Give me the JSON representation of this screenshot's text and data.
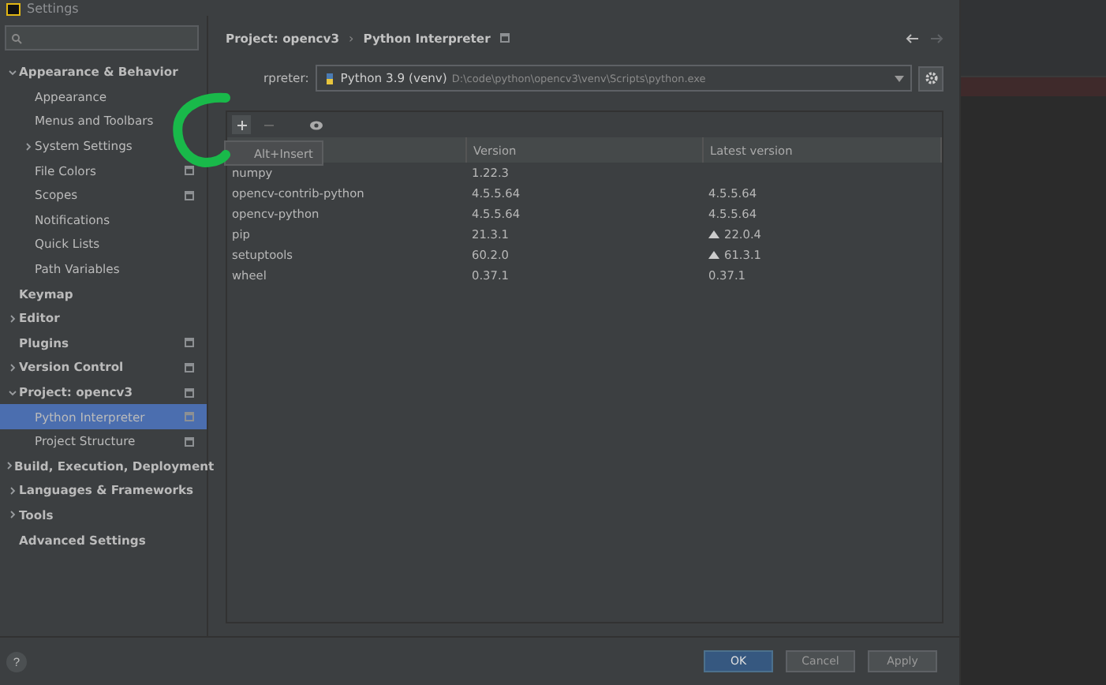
{
  "window": {
    "title": "Settings"
  },
  "breadcrumb_separator": "›",
  "sidebar": {
    "items": [
      {
        "label": "Appearance & Behavior",
        "bold": true,
        "expanded": true,
        "selected": false,
        "children": [
          {
            "label": "Appearance",
            "selected": false
          },
          {
            "label": "Menus and Toolbars",
            "selected": false
          },
          {
            "label": "System Settings",
            "expanded": false,
            "selected": false
          },
          {
            "label": "File Colors",
            "project_scope": true,
            "selected": false
          },
          {
            "label": "Scopes",
            "project_scope": true,
            "selected": false
          },
          {
            "label": "Notifications",
            "selected": false
          },
          {
            "label": "Quick Lists",
            "selected": false
          },
          {
            "label": "Path Variables",
            "selected": false
          }
        ]
      },
      {
        "label": "Keymap",
        "bold": true,
        "selected": false
      },
      {
        "label": "Editor",
        "bold": true,
        "expanded": false,
        "selected": false
      },
      {
        "label": "Plugins",
        "bold": true,
        "project_scope": true,
        "selected": false
      },
      {
        "label": "Version Control",
        "bold": true,
        "expanded": false,
        "project_scope": true,
        "selected": false
      },
      {
        "label": "Project: opencv3",
        "bold": true,
        "expanded": true,
        "project_scope": true,
        "selected": false,
        "children": [
          {
            "label": "Python Interpreter",
            "project_scope": true,
            "selected": true
          },
          {
            "label": "Project Structure",
            "project_scope": true,
            "selected": false
          }
        ]
      },
      {
        "label": "Build, Execution, Deployment",
        "bold": true,
        "expanded": false,
        "selected": false
      },
      {
        "label": "Languages & Frameworks",
        "bold": true,
        "expanded": false,
        "selected": false
      },
      {
        "label": "Tools",
        "bold": true,
        "expanded": false,
        "selected": false
      },
      {
        "label": "Advanced Settings",
        "bold": true,
        "selected": false
      }
    ]
  },
  "breadcrumb": [
    "Project: opencv3",
    "Python Interpreter"
  ],
  "interpreter": {
    "label": "rpreter:",
    "name": "Python 3.9 (venv)",
    "path": "D:\\code\\python\\opencv3\\venv\\Scripts\\python.exe"
  },
  "tooltip": "Alt+Insert",
  "table": {
    "columns": [
      "Version",
      "Latest version"
    ],
    "rows": [
      {
        "package": "numpy",
        "version": "1.22.3",
        "upgrade": false
      },
      {
        "package": "opencv-contrib-python",
        "version": "4.5.5.64",
        "latest": "4.5.5.64",
        "upgrade": false
      },
      {
        "package": "opencv-python",
        "version": "4.5.5.64",
        "latest": "4.5.5.64",
        "upgrade": false
      },
      {
        "package": "pip",
        "version": "21.3.1",
        "latest": "22.0.4",
        "upgrade": true
      },
      {
        "package": "setuptools",
        "version": "60.2.0",
        "latest": "61.3.1",
        "upgrade": true
      },
      {
        "package": "wheel",
        "version": "0.37.1",
        "latest": "0.37.1",
        "upgrade": false
      }
    ]
  },
  "buttons": [
    {
      "label": "OK",
      "primary": true
    },
    {
      "label": "Cancel",
      "primary": false
    },
    {
      "label": "Apply",
      "primary": false
    }
  ],
  "help": "?"
}
